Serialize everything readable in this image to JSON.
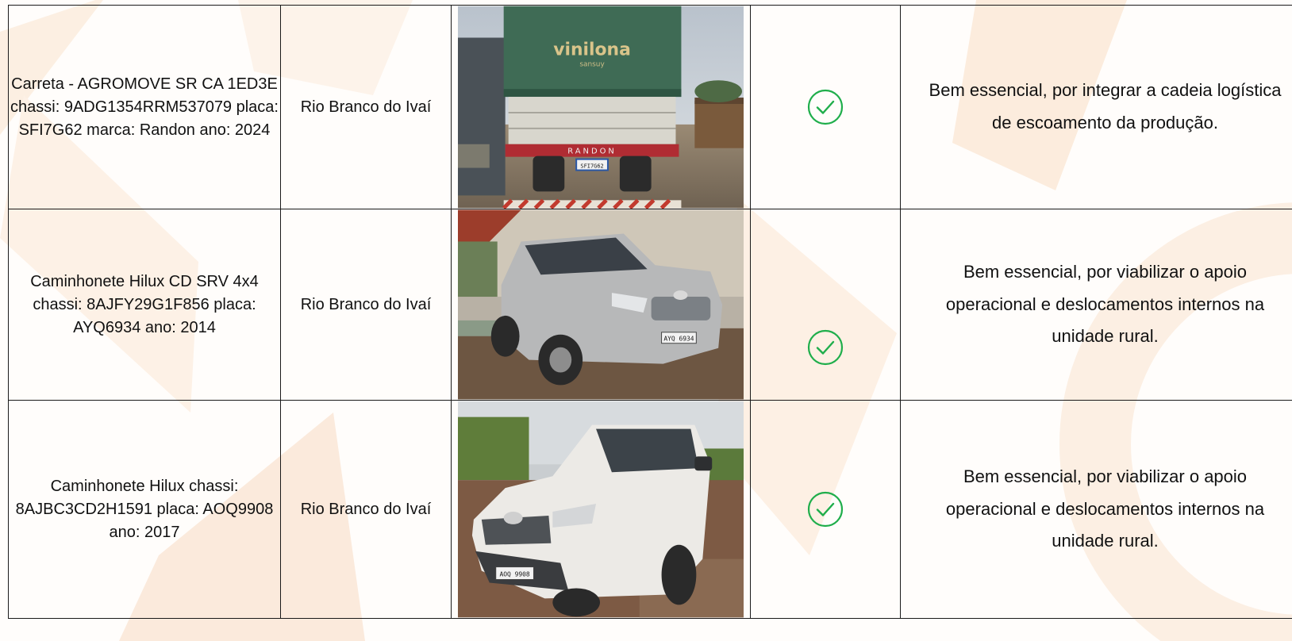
{
  "colors": {
    "check_green": "#1fae4b",
    "watermark": "#fbe7d4",
    "border": "#1a1a1a"
  },
  "rows": [
    {
      "description": "Carreta - AGROMOVE SR CA 1ED3E chassi: 9ADG1354RRM537079 placa: SFI7G62 marca: Randon ano: 2024",
      "location": "Rio Branco do Ivaí",
      "photo": {
        "icon": "truck-trailer-photo",
        "tarp_brand": "vinilona",
        "tarp_sub": "sansuy",
        "trailer_brand": "RANDON",
        "plate": "SFI7G62"
      },
      "status_icon": "check-circle-icon",
      "justification": "Bem essencial, por integrar a cadeia logística de escoamento da produção."
    },
    {
      "description": "Caminhonete Hilux CD SRV 4x4 chassi: 8AJFY29G1F856 placa: AYQ6934  ano: 2014",
      "location": "Rio Branco do Ivaí",
      "photo": {
        "icon": "pickup-truck-photo",
        "plate": "AYQ 6934"
      },
      "status_icon": "check-circle-icon",
      "justification": "Bem essencial, por viabilizar o apoio operacional e deslocamentos internos na unidade rural."
    },
    {
      "description": "Caminhonete Hilux chassi: 8AJBC3CD2H1591 placa: AOQ9908 ano: 2017",
      "location": "Rio Branco do Ivaí",
      "photo": {
        "icon": "pickup-truck-photo",
        "plate": "AOQ 9908"
      },
      "status_icon": "check-circle-icon",
      "justification": "Bem essencial, por viabilizar o apoio operacional e deslocamentos internos na unidade rural."
    }
  ]
}
